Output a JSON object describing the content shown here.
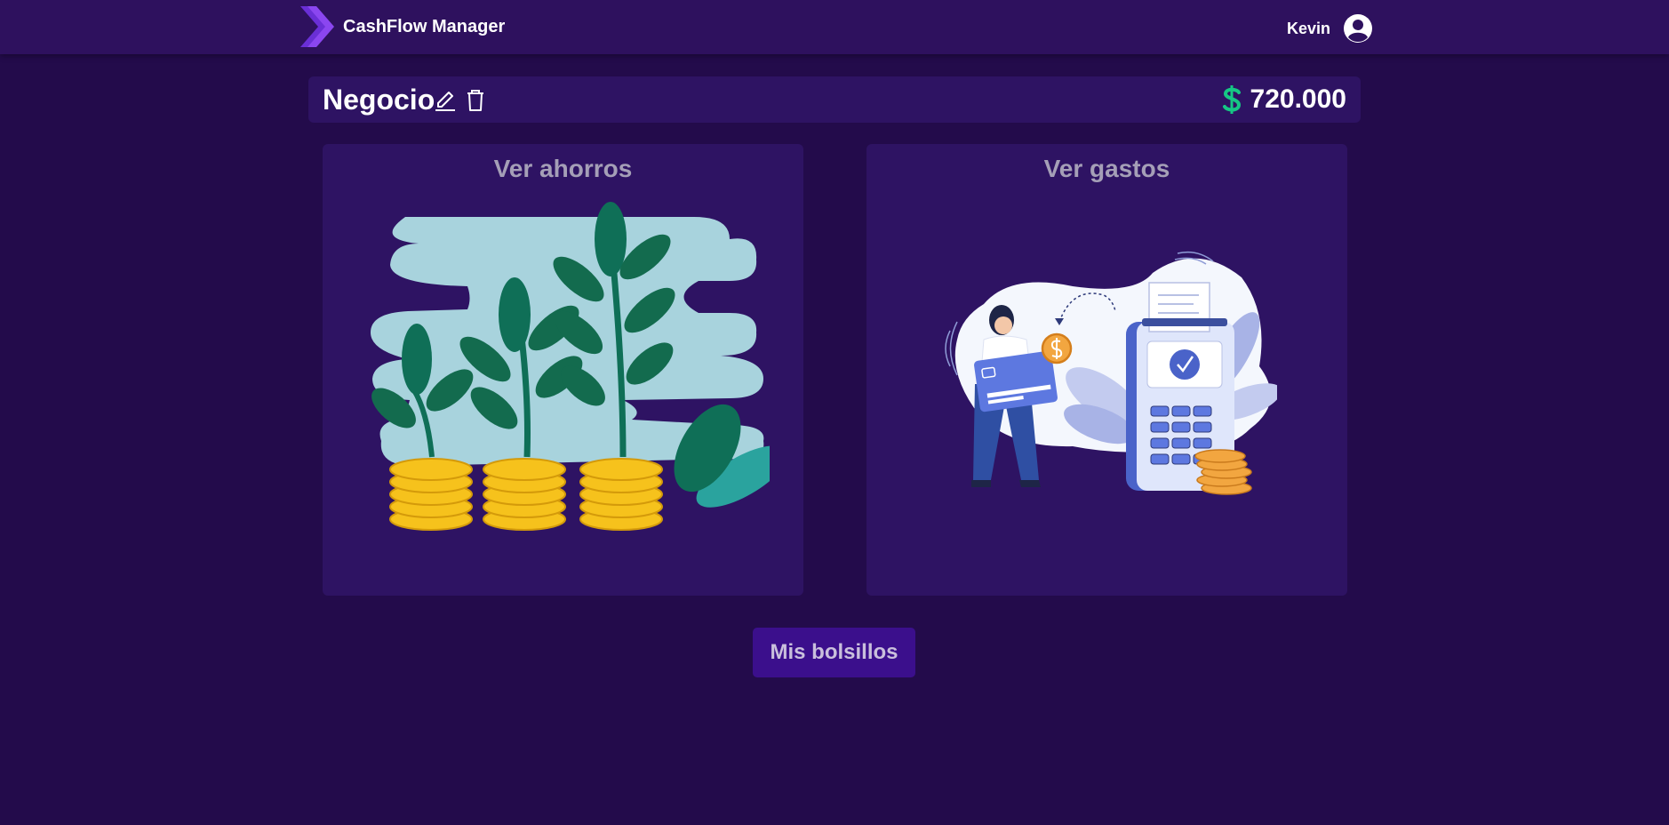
{
  "navbar": {
    "brand": "CashFlow Manager",
    "brand_icon": "chevron-logo-icon",
    "user_name": "Kevin",
    "user_icon": "user-circle-icon"
  },
  "pocket": {
    "name": "Negocio",
    "edit_icon": "pencil-icon",
    "delete_icon": "trash-icon",
    "currency_icon": "dollar-icon",
    "balance": "720.000"
  },
  "cards": {
    "savings": {
      "title": "Ver ahorros",
      "illustration": "plants-coins-illustration"
    },
    "expenses": {
      "title": "Ver gastos",
      "illustration": "card-payment-terminal-illustration"
    }
  },
  "actions": {
    "pockets_label": "Mis bolsillos"
  },
  "colors": {
    "background": "#230b4b",
    "navbar": "#2e115e",
    "panel": "#2e1363",
    "accent_green": "#16c784",
    "button": "#3b0f8c",
    "muted_text": "#a59fb7"
  }
}
